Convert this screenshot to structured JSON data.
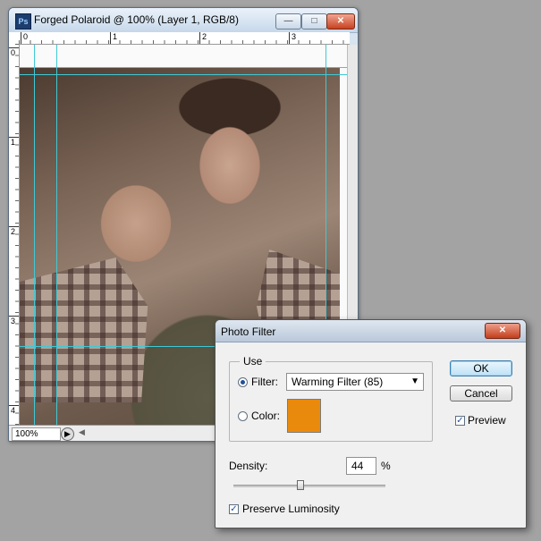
{
  "document_window": {
    "title": "Forged Polaroid @ 100% (Layer 1, RGB/8)",
    "app_icon": "photoshop-icon",
    "ruler_top_labels": [
      "0",
      "1",
      "2",
      "3"
    ],
    "ruler_left_labels": [
      "0",
      "1",
      "2",
      "3",
      "4"
    ],
    "zoom": "100%",
    "guide_color": "#3ec9d6"
  },
  "dialog": {
    "title": "Photo Filter",
    "use_label": "Use",
    "filter_label": "Filter:",
    "filter_value": "Warming Filter (85)",
    "filter_selected": true,
    "color_label": "Color:",
    "color_selected": false,
    "color_swatch": "#ea8a0d",
    "density_label": "Density:",
    "density_value": "44",
    "density_unit": "%",
    "density_fraction": 0.44,
    "preserve_luminosity_label": "Preserve Luminosity",
    "preserve_luminosity_checked": true,
    "ok_label": "OK",
    "cancel_label": "Cancel",
    "preview_label": "Preview",
    "preview_checked": true
  }
}
